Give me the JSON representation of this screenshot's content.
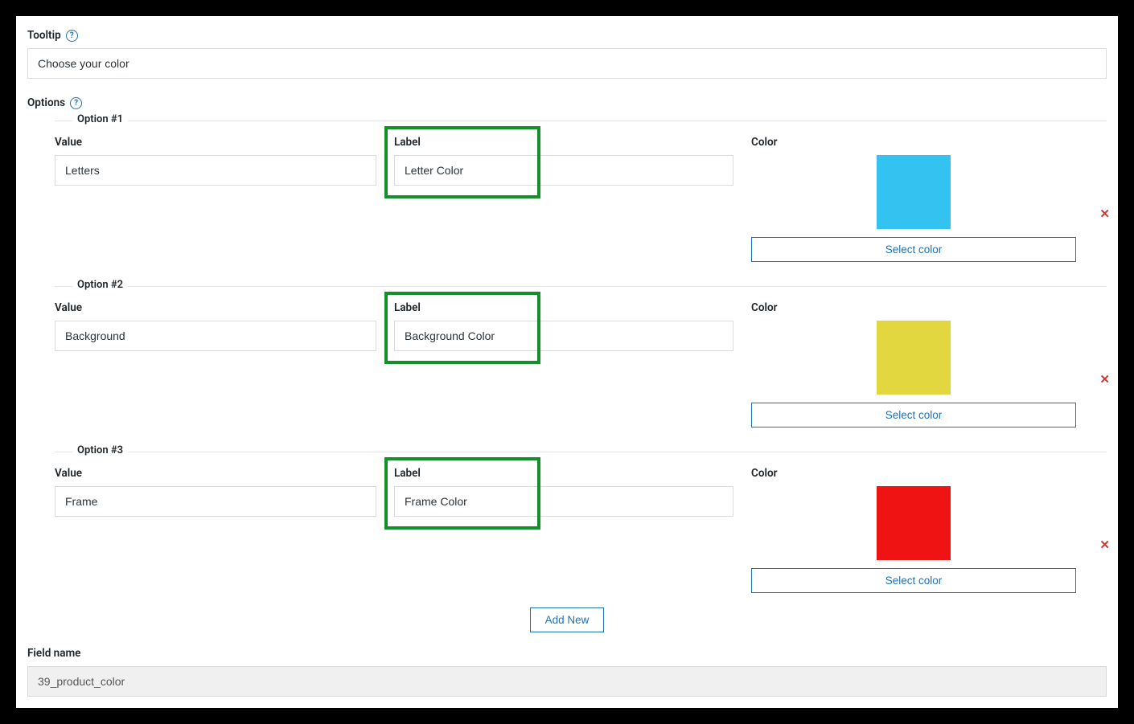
{
  "tooltip": {
    "section_label": "Tooltip",
    "value": "Choose your color"
  },
  "options_section": {
    "section_label": "Options"
  },
  "column_labels": {
    "value": "Value",
    "label": "Label",
    "color": "Color"
  },
  "options": [
    {
      "legend": "Option #1",
      "value": "Letters",
      "label": "Letter Color",
      "swatch_color": "#34c3f0",
      "select_color": "Select color"
    },
    {
      "legend": "Option #2",
      "value": "Background",
      "label": "Background Color",
      "swatch_color": "#e3d740",
      "select_color": "Select color"
    },
    {
      "legend": "Option #3",
      "value": "Frame",
      "label": "Frame Color",
      "swatch_color": "#ef1313",
      "select_color": "Select color"
    }
  ],
  "buttons": {
    "add_new": "Add New"
  },
  "field_name": {
    "section_label": "Field name",
    "value": "39_product_color"
  }
}
